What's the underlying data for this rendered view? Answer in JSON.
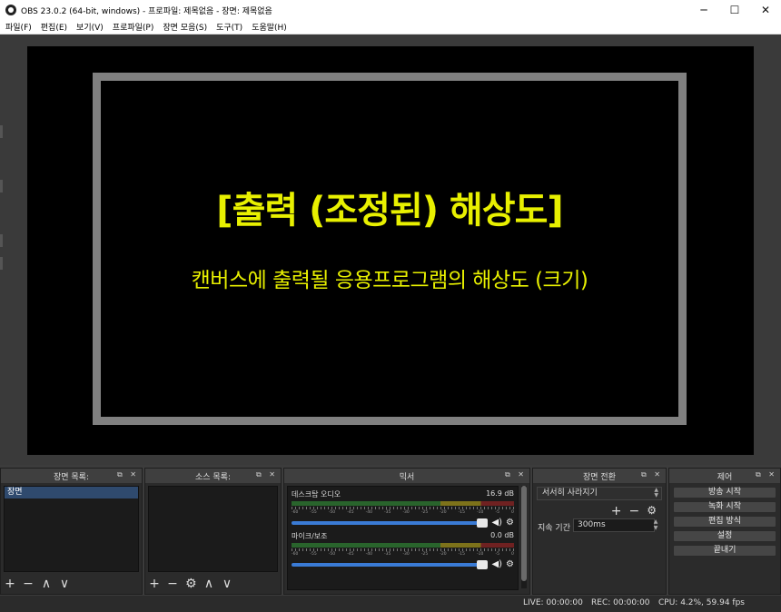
{
  "window": {
    "title": "OBS 23.0.2 (64-bit, windows) - 프로파일: 제목없음 - 장면: 제목없음",
    "minimize": "─",
    "maximize": "☐",
    "close": "✕"
  },
  "menu": [
    "파일(F)",
    "편집(E)",
    "보기(V)",
    "프로파일(P)",
    "장면 모음(S)",
    "도구(T)",
    "도움말(H)"
  ],
  "preview": {
    "headline": "[출력 (조정된) 해상도]",
    "subline": "캔버스에 출력될 응용프로그램의 해상도 (크기)",
    "text_color": "#e8f000",
    "frame_color": "#808080"
  },
  "docks": {
    "scenes": {
      "title": "장면 목록:",
      "items": [
        "장면"
      ]
    },
    "sources": {
      "title": "소스 목록:"
    },
    "mixer": {
      "title": "믹서",
      "channels": [
        {
          "name": "데스크탑 오디오",
          "level": "16.9 dB",
          "volume": 1.0
        },
        {
          "name": "마이크/보조",
          "level": "0.0 dB",
          "volume": 1.0
        }
      ],
      "ticks": [
        "-60",
        "-55",
        "-50",
        "-45",
        "-40",
        "-35",
        "-30",
        "-25",
        "-20",
        "-15",
        "-10",
        "-5",
        "0"
      ]
    },
    "transitions": {
      "title": "장면 전환",
      "selected": "서서히 사라지기",
      "duration_label": "지속 기간",
      "duration_value": "300ms"
    },
    "controls": {
      "title": "제어",
      "buttons": [
        "방송 시작",
        "녹화 시작",
        "편집 방식",
        "설정",
        "끝내기"
      ]
    },
    "dock_ctrls": "⧉ ✕"
  },
  "toolbar_glyphs": {
    "add": "+",
    "remove": "−",
    "up": "∧",
    "down": "∨",
    "gear": "⚙",
    "speaker": "🔊"
  },
  "status": {
    "live": "LIVE: 00:00:00",
    "rec": "REC: 00:00:00",
    "cpu": "CPU: 4.2%, 59.94 fps"
  }
}
